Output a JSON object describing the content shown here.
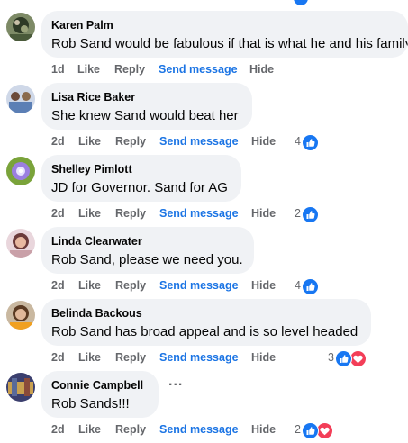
{
  "comments": [
    {
      "author": "Karen Palm",
      "text": "Rob Sand would be fabulous if that is what he and his family",
      "time": "1d",
      "like": "Like",
      "reply": "Reply",
      "send": "Send message",
      "hide": "Hide",
      "reaction_count": "",
      "reactions": [],
      "avatar_color": "#4a5a3a"
    },
    {
      "author": "Lisa Rice Baker",
      "text": "She knew Sand would beat her",
      "time": "2d",
      "like": "Like",
      "reply": "Reply",
      "send": "Send message",
      "hide": "Hide",
      "reaction_count": "4",
      "reactions": [
        "like-icon"
      ],
      "avatar_color": "#5b7fb5"
    },
    {
      "author": "Shelley Pimlott",
      "text": "JD for Governor. Sand for AG",
      "time": "2d",
      "like": "Like",
      "reply": "Reply",
      "send": "Send message",
      "hide": "Hide",
      "reaction_count": "2",
      "reactions": [
        "like-icon"
      ],
      "avatar_color": "#6a8f2e"
    },
    {
      "author": "Linda Clearwater",
      "text": "Rob Sand, please we need you.",
      "time": "2d",
      "like": "Like",
      "reply": "Reply",
      "send": "Send message",
      "hide": "Hide",
      "reaction_count": "4",
      "reactions": [
        "like-icon"
      ],
      "avatar_color": "#c9a0a8"
    },
    {
      "author": "Belinda Backous",
      "text": "Rob Sand has broad appeal and is so level headed",
      "time": "2d",
      "like": "Like",
      "reply": "Reply",
      "send": "Send message",
      "hide": "Hide",
      "reaction_count": "3",
      "reactions": [
        "like-icon",
        "love-icon"
      ],
      "avatar_color": "#8a6a4e"
    },
    {
      "author": "Connie Campbell",
      "text": "Rob Sands!!!",
      "time": "2d",
      "like": "Like",
      "reply": "Reply",
      "send": "Send message",
      "hide": "Hide",
      "reaction_count": "2",
      "reactions": [
        "like-icon",
        "love-icon"
      ],
      "more_options": "...",
      "avatar_color": "#3b3f6e"
    }
  ],
  "colors": {
    "link_blue": "#1b74e4",
    "like_blue": "#1877f2",
    "love_red": "#f33e58",
    "muted": "#65676b",
    "bubble": "#f0f2f5"
  }
}
